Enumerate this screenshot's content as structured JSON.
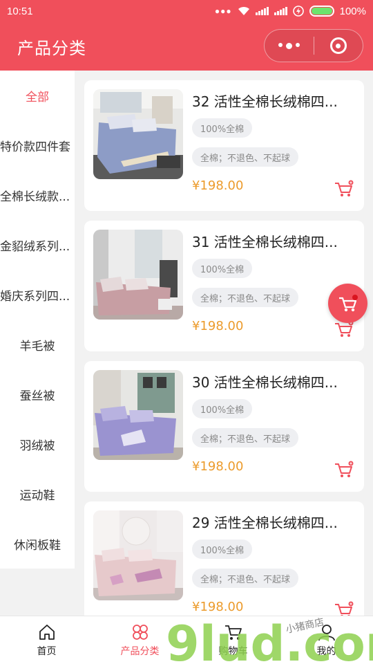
{
  "status_bar": {
    "time": "10:51",
    "battery": "100%"
  },
  "nav": {
    "title": "产品分类"
  },
  "sidebar": {
    "items": [
      {
        "label": "全部"
      },
      {
        "label": "特价款四件套"
      },
      {
        "label": "全棉长绒款..."
      },
      {
        "label": "金貂绒系列..."
      },
      {
        "label": "婚庆系列四..."
      },
      {
        "label": "羊毛被"
      },
      {
        "label": "蚕丝被"
      },
      {
        "label": "羽绒被"
      },
      {
        "label": "运动鞋"
      },
      {
        "label": "休闲板鞋"
      }
    ]
  },
  "products": [
    {
      "title": "32 活性全棉长绒棉四...",
      "tag1": "100%全棉",
      "tag2": "全棉；不退色、不起球",
      "price": "¥198.00"
    },
    {
      "title": "31 活性全棉长绒棉四...",
      "tag1": "100%全棉",
      "tag2": "全棉；不退色、不起球",
      "price": "¥198.00"
    },
    {
      "title": "30 活性全棉长绒棉四...",
      "tag1": "100%全棉",
      "tag2": "全棉；不退色、不起球",
      "price": "¥198.00"
    },
    {
      "title": "29 活性全棉长绒棉四...",
      "tag1": "100%全棉",
      "tag2": "全棉；不退色、不起球",
      "price": "¥198.00"
    }
  ],
  "tabs": [
    {
      "label": "首页",
      "icon": "home-icon"
    },
    {
      "label": "产品分类",
      "icon": "category-icon"
    },
    {
      "label": "购物车",
      "icon": "cart-icon"
    },
    {
      "label": "我的",
      "icon": "user-icon"
    }
  ],
  "watermark": {
    "text": "9lud.com",
    "subtext": "小猪商店"
  },
  "colors": {
    "accent": "#f04f5b",
    "price": "#ec9b2c"
  }
}
